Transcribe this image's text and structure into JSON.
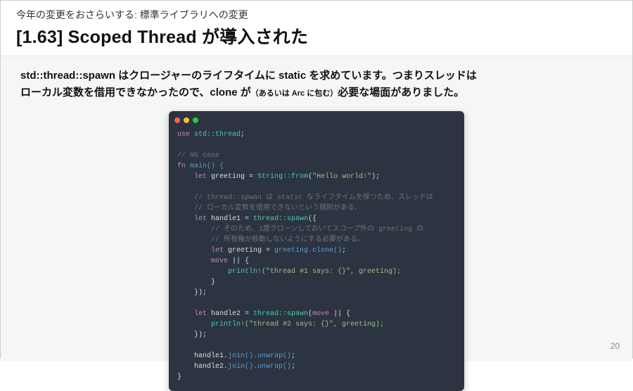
{
  "header": {
    "subtitle": "今年の変更をおさらいする: 標準ライブラリへの変更",
    "title": "[1.63] Scoped Thread が導入された"
  },
  "desc": {
    "l1a": "std::thread::spawn はクロージャーのライフタイムに static を求めています。つまりスレッドは",
    "l2a": "ローカル変数を借用できなかったので、clone が",
    "l2small": "（あるいは Arc に包む）",
    "l2b": "必要な場面がありました。"
  },
  "code": {
    "use_kw": "use",
    "use_path": " std::thread",
    "semi": ";",
    "ng_comment": "// NG case",
    "fn_kw": "fn",
    "main_sig": " main() {",
    "let_kw": "let",
    "greeting_decl": " greeting = ",
    "string_from": "String::from",
    "hello_str": "\"Hello world!\"",
    "close_paren_semi": ");",
    "comment_static1": "// thread::spwan は static なライフタイムを保つため、スレッドは",
    "comment_static2": "// ローカル変数を借用できないという規則がある。",
    "handle1_decl": " handle1 = ",
    "thread_spawn": "thread::spawn",
    "open_brace_arg": "({",
    "comment_scope1": "// そのため、1度クローンしておいてスコープ外の greeting の",
    "comment_scope2": "// 所有権が移動しないようにする必要がある。",
    "greeting_clone_decl": " greeting = ",
    "greeting_clone_call": "greeting.clone()",
    "move_kw": "move",
    "closure_open": " || {",
    "println_mac": "println!",
    "println1_arg": "(\"thread #1 says: {}\", greeting);",
    "close_brace": "}",
    "close_brace_paren_semi": "});",
    "handle2_decl": " handle2 = ",
    "spawn_move_open": "(",
    "println2_arg": "(\"thread #2 says: {}\", greeting);",
    "handle1_join": "handle1.",
    "handle2_join": "handle2.",
    "join_call": "join().unwrap()"
  },
  "page_number": "20"
}
